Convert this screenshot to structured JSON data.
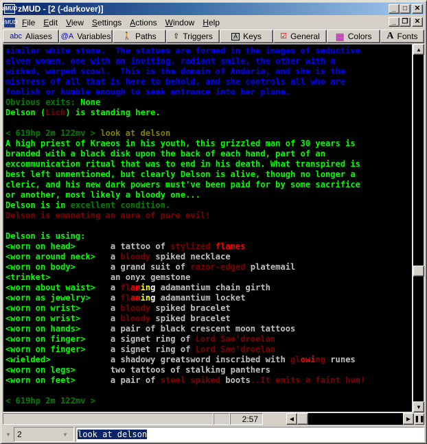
{
  "window": {
    "title": "zMUD - [2 (-darkover)]",
    "app_icon_label": "zMUD",
    "buttons": {
      "minimize": "_",
      "maximize": "□",
      "close": "✕",
      "restore": "❐"
    }
  },
  "menubar": {
    "items": [
      {
        "label": "File",
        "accel": "F"
      },
      {
        "label": "Edit",
        "accel": "E"
      },
      {
        "label": "View",
        "accel": "V"
      },
      {
        "label": "Settings",
        "accel": "S"
      },
      {
        "label": "Actions",
        "accel": "A"
      },
      {
        "label": "Window",
        "accel": "W"
      },
      {
        "label": "Help",
        "accel": "H"
      }
    ]
  },
  "toolbar": {
    "buttons": [
      {
        "id": "aliases",
        "label": "Aliases",
        "icon": "abc-icon",
        "glyph": "abc",
        "color": "#0000c0"
      },
      {
        "id": "variables",
        "label": "Variables",
        "icon": "at-a-icon",
        "glyph": "@A",
        "color": "#0000c0"
      },
      {
        "id": "paths",
        "label": "Paths",
        "icon": "walking-man-icon",
        "glyph": "🚶",
        "color": "#008080"
      },
      {
        "id": "triggers",
        "label": "Triggers",
        "icon": "trigger-gun-icon",
        "glyph": "⇧",
        "color": "#000000"
      },
      {
        "id": "keys",
        "label": "Keys",
        "icon": "key-cap-icon",
        "glyph": "A",
        "color": "#000000"
      },
      {
        "id": "general",
        "label": "General",
        "icon": "checkbox-icon",
        "glyph": "☑",
        "color": "#c00000"
      },
      {
        "id": "colors",
        "label": "Colors",
        "icon": "color-grid-icon",
        "glyph": "▦",
        "color": "#c000c0"
      },
      {
        "id": "fonts",
        "label": "Fonts",
        "icon": "font-a-icon",
        "glyph": "A",
        "color": "#000000"
      }
    ]
  },
  "colors": {
    "blue": "#0000ff",
    "green": "#00ff00",
    "dkgreen": "#008000",
    "olive": "#808000",
    "dkred": "#800000",
    "red": "#ff0000",
    "yellow": "#ffff00",
    "white": "#ffffff",
    "gray": "#c0c0c0"
  },
  "terminal": {
    "lines": [
      [
        {
          "t": "similar white stone.  The statues are formed in the images of seductive",
          "c": "blue"
        }
      ],
      [
        {
          "t": "elven women, one with an inviting, radiant smile, the other with a",
          "c": "blue"
        }
      ],
      [
        {
          "t": "wicked, warped scowl.  This is the domain of Andaria, and she is the",
          "c": "blue"
        }
      ],
      [
        {
          "t": "mistress of all that is here to behold, and she controls all who are",
          "c": "blue"
        }
      ],
      [
        {
          "t": "foolish or humble enough to seek entrance into her plane.",
          "c": "blue"
        }
      ],
      [
        {
          "t": "Obvious exits: ",
          "c": "dkgreen"
        },
        {
          "t": "None",
          "c": "green"
        }
      ],
      [
        {
          "t": "Delson (",
          "c": "green"
        },
        {
          "t": "Lich",
          "c": "dkred"
        },
        {
          "t": ") is standing here.",
          "c": "green"
        }
      ],
      [],
      [
        {
          "t": "< 619hp 2m 122mv > ",
          "c": "dkgreen"
        },
        {
          "t": "look at delson",
          "c": "olive"
        }
      ],
      [
        {
          "t": "A high priest of Kraeos in his youth, this grizzled man of 30 years is",
          "c": "green"
        }
      ],
      [
        {
          "t": "branded with a black disk upon the back of each hand, part of an",
          "c": "green"
        }
      ],
      [
        {
          "t": "excommunication ritual that was to end in his death. What transpired is",
          "c": "green"
        }
      ],
      [
        {
          "t": "best left unmentioned, but clearly Delson is alive, though no longer a",
          "c": "green"
        }
      ],
      [
        {
          "t": "cleric, and his new dark powers must've been paid for by some sacrifice",
          "c": "green"
        }
      ],
      [
        {
          "t": "or another, most likely a bloody one...",
          "c": "green"
        }
      ],
      [
        {
          "t": "Delson is in ",
          "c": "green"
        },
        {
          "t": "excellent condition.",
          "c": "dkgreen"
        }
      ],
      [
        {
          "t": "Delson is emanating an aura of pure evil!",
          "c": "dkred"
        }
      ],
      [],
      [
        {
          "t": "Delson is using:",
          "c": "green"
        }
      ],
      [
        {
          "t": "<worn on head>       ",
          "c": "green"
        },
        {
          "t": "a tattoo of ",
          "c": "gray"
        },
        {
          "t": "stylized ",
          "c": "dkred"
        },
        {
          "t": "flames",
          "c": "red"
        }
      ],
      [
        {
          "t": "<worn around neck>   ",
          "c": "green"
        },
        {
          "t": "a ",
          "c": "gray"
        },
        {
          "t": "bloody",
          "c": "dkred"
        },
        {
          "t": " spiked necklace",
          "c": "gray"
        }
      ],
      [
        {
          "t": "<worn on body>       ",
          "c": "green"
        },
        {
          "t": "a grand suit of ",
          "c": "gray"
        },
        {
          "t": "razor-edged",
          "c": "dkred"
        },
        {
          "t": " platemail",
          "c": "gray"
        }
      ],
      [
        {
          "t": "<trinket>            ",
          "c": "green"
        },
        {
          "t": "an onyx gemstone",
          "c": "gray"
        }
      ],
      [
        {
          "t": "<worn about waist>   ",
          "c": "green"
        },
        {
          "t": "a ",
          "c": "gray"
        },
        {
          "t": "fl",
          "c": "dkred"
        },
        {
          "t": "am",
          "c": "red"
        },
        {
          "t": "in",
          "c": "yellow"
        },
        {
          "t": "g",
          "c": "white"
        },
        {
          "t": " adamantium chain girth",
          "c": "gray"
        }
      ],
      [
        {
          "t": "<worn as jewelry>    ",
          "c": "green"
        },
        {
          "t": "a ",
          "c": "gray"
        },
        {
          "t": "fl",
          "c": "dkred"
        },
        {
          "t": "am",
          "c": "red"
        },
        {
          "t": "in",
          "c": "yellow"
        },
        {
          "t": "g",
          "c": "white"
        },
        {
          "t": " adamantium locket",
          "c": "gray"
        }
      ],
      [
        {
          "t": "<worn on wrist>      ",
          "c": "green"
        },
        {
          "t": "a ",
          "c": "gray"
        },
        {
          "t": "bloody",
          "c": "dkred"
        },
        {
          "t": " spiked bracelet",
          "c": "gray"
        }
      ],
      [
        {
          "t": "<worn on wrist>      ",
          "c": "green"
        },
        {
          "t": "a ",
          "c": "gray"
        },
        {
          "t": "bloody",
          "c": "dkred"
        },
        {
          "t": " spiked bracelet",
          "c": "gray"
        }
      ],
      [
        {
          "t": "<worn on hands>      ",
          "c": "green"
        },
        {
          "t": "a pair of black crescent moon tattoos",
          "c": "gray"
        }
      ],
      [
        {
          "t": "<worn on finger>     ",
          "c": "green"
        },
        {
          "t": "a signet ring of ",
          "c": "gray"
        },
        {
          "t": "Lord Sae'droelan",
          "c": "dkred"
        }
      ],
      [
        {
          "t": "<worn on finger>     ",
          "c": "green"
        },
        {
          "t": "a signet ring of ",
          "c": "gray"
        },
        {
          "t": "Lord Sae'droelan",
          "c": "dkred"
        }
      ],
      [
        {
          "t": "<wielded>            ",
          "c": "green"
        },
        {
          "t": "a shadowy greatsword inscribed with ",
          "c": "gray"
        },
        {
          "t": "gl",
          "c": "dkred"
        },
        {
          "t": "owi",
          "c": "red"
        },
        {
          "t": "ng",
          "c": "dkred"
        },
        {
          "t": " runes",
          "c": "gray"
        }
      ],
      [
        {
          "t": "<worn on legs>       ",
          "c": "green"
        },
        {
          "t": "two tattoos of stalking panthers",
          "c": "gray"
        }
      ],
      [
        {
          "t": "<worn on feet>       ",
          "c": "green"
        },
        {
          "t": "a pair of ",
          "c": "gray"
        },
        {
          "t": "steel spiked",
          "c": "dkred"
        },
        {
          "t": " boots",
          "c": "gray"
        },
        {
          "t": "..It emits a faint hum!",
          "c": "dkred"
        }
      ],
      [],
      [
        {
          "t": "< 619hp 2m 122mv >",
          "c": "dkgreen"
        }
      ]
    ]
  },
  "statusbar": {
    "clock": "2:57"
  },
  "inputbar": {
    "session_value": "2",
    "command_value": "look at delson"
  }
}
